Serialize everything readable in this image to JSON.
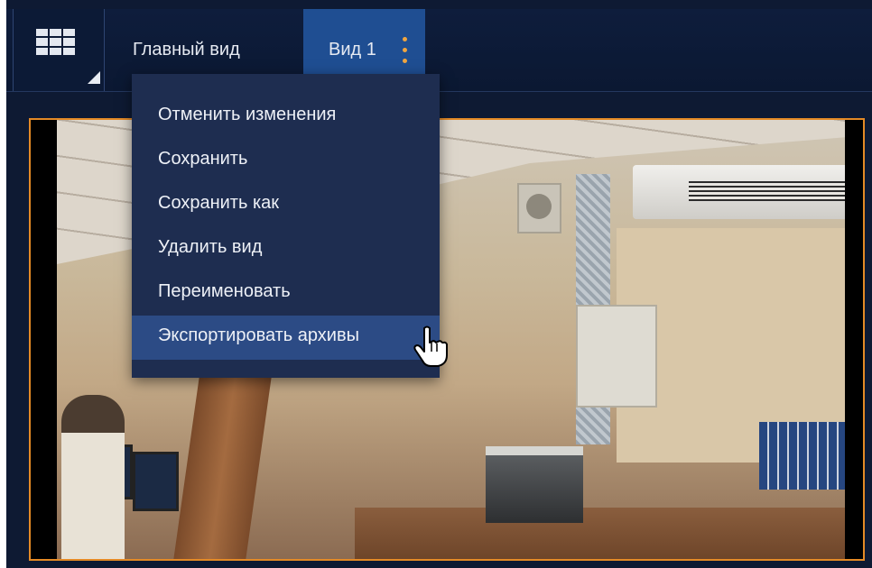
{
  "toolbar": {
    "layout_button_icon": "grid-layout-icon",
    "tabs": [
      {
        "label": "Главный вид",
        "active": false
      },
      {
        "label": "Вид 1",
        "active": true,
        "menu_icon": "vertical-dots-icon"
      }
    ]
  },
  "view_menu": {
    "items": [
      {
        "label": "Отменить изменения"
      },
      {
        "label": "Сохранить"
      },
      {
        "label": "Сохранить как"
      },
      {
        "label": "Удалить вид"
      },
      {
        "label": "Переименовать"
      },
      {
        "label": "Экспортировать архивы",
        "hovered": true
      }
    ]
  },
  "video_tile": {
    "selected": true,
    "border_color": "#e48a26"
  },
  "colors": {
    "background": "#0e1a33",
    "active_tab": "#1f4e92",
    "menu_background": "#1e2d50",
    "menu_hover": "#2c4b85",
    "accent": "#f0a640"
  },
  "cursor": "hand-pointer-icon"
}
